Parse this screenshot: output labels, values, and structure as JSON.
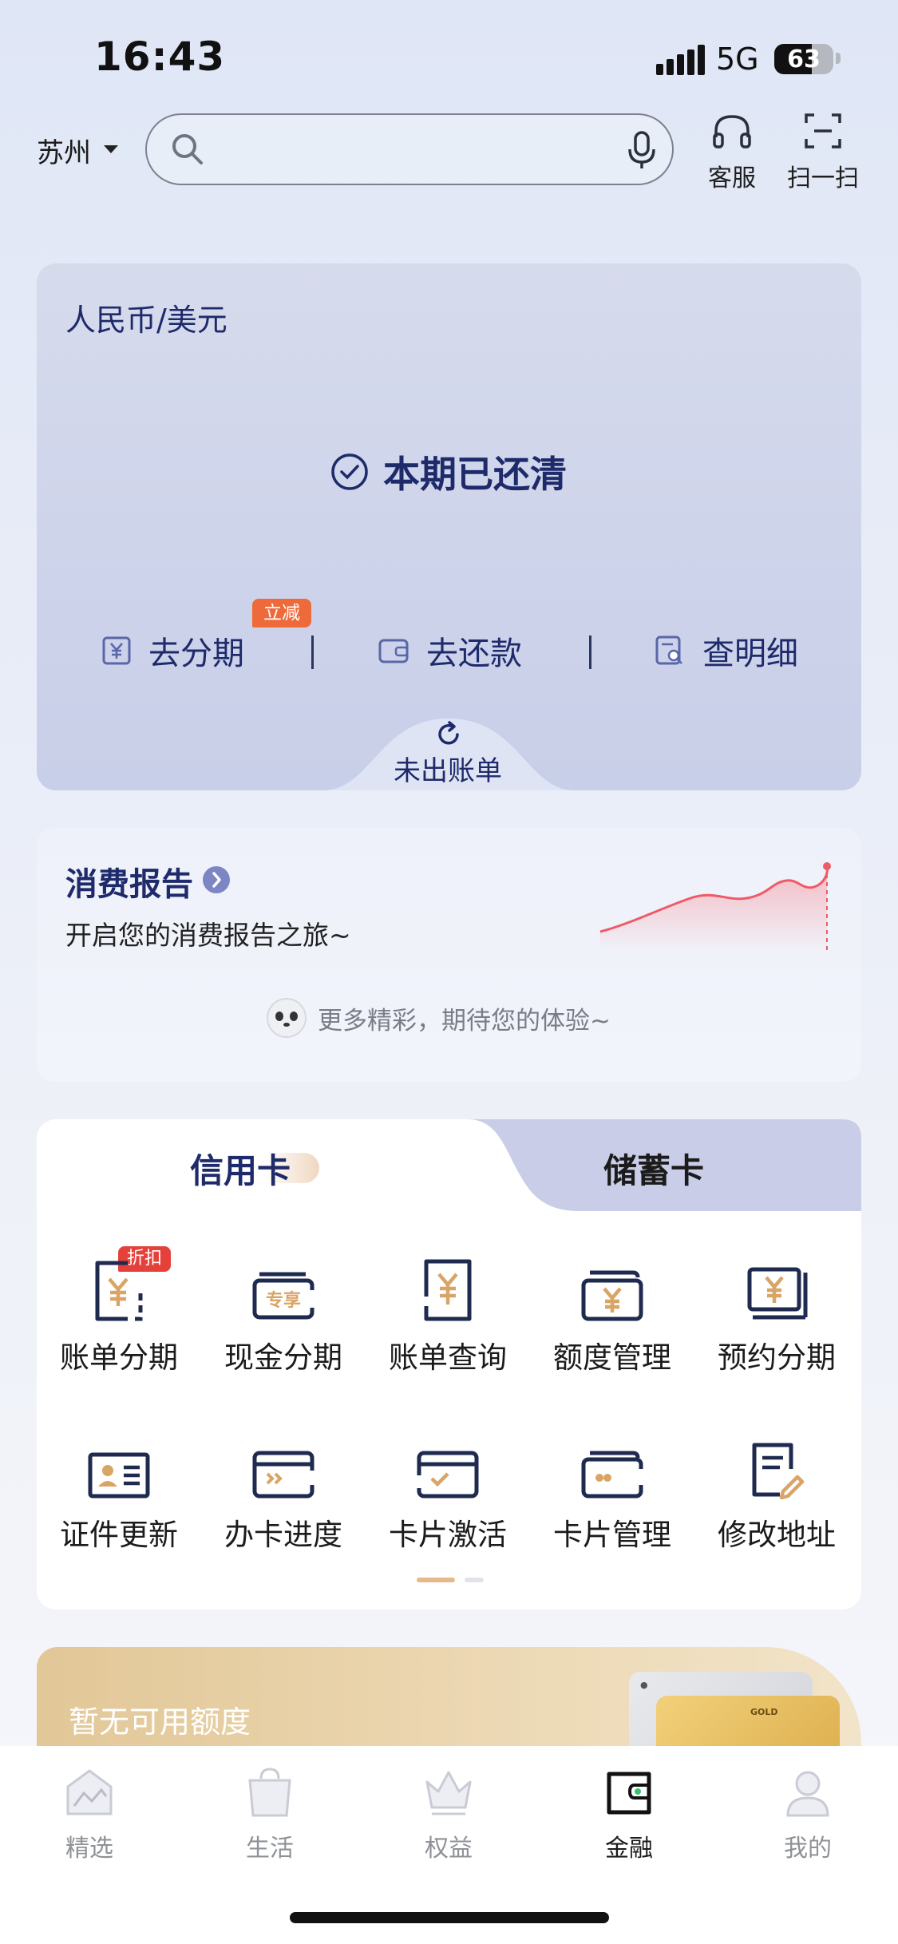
{
  "status_bar": {
    "time": "16:43",
    "network": "5G",
    "battery": "63"
  },
  "header": {
    "city": "苏州",
    "search_placeholder": "",
    "service_label": "客服",
    "scan_label": "扫一扫"
  },
  "bill_card": {
    "currency": "人民币/美元",
    "status": "本期已还清",
    "actions": [
      {
        "label": "去分期",
        "badge": "立减"
      },
      {
        "label": "去还款"
      },
      {
        "label": "查明细"
      }
    ],
    "not_billed": "未出账单"
  },
  "report": {
    "title": "消费报告",
    "subtitle": "开启您的消费报告之旅~",
    "more": "更多精彩，期待您的体验~"
  },
  "card_services": {
    "tabs": [
      "信用卡",
      "储蓄卡"
    ],
    "active_tab": 0,
    "row1": [
      {
        "label": "账单分期",
        "icon": "bill-installment-icon",
        "badge": "折扣"
      },
      {
        "label": "现金分期",
        "icon": "cash-installment-icon",
        "icon_text": "专享"
      },
      {
        "label": "账单查询",
        "icon": "bill-query-icon"
      },
      {
        "label": "额度管理",
        "icon": "limit-manage-icon"
      },
      {
        "label": "预约分期",
        "icon": "reserve-installment-icon"
      }
    ],
    "row2": [
      {
        "label": "证件更新",
        "icon": "id-update-icon"
      },
      {
        "label": "办卡进度",
        "icon": "card-progress-icon"
      },
      {
        "label": "卡片激活",
        "icon": "card-activate-icon"
      },
      {
        "label": "卡片管理",
        "icon": "card-manage-icon"
      },
      {
        "label": "修改地址",
        "icon": "edit-address-icon"
      }
    ],
    "page_indicator": {
      "pages": 2,
      "current": 1
    }
  },
  "promo": {
    "text": "暂无可用额度",
    "card_label": "GOLD"
  },
  "tab_bar": {
    "items": [
      {
        "label": "精选",
        "icon": "featured-icon"
      },
      {
        "label": "生活",
        "icon": "life-icon"
      },
      {
        "label": "权益",
        "icon": "rights-icon"
      },
      {
        "label": "金融",
        "icon": "finance-icon",
        "active": true
      },
      {
        "label": "我的",
        "icon": "profile-icon"
      }
    ]
  },
  "colors": {
    "brand_navy": "#1f2a6b",
    "accent_red": "#e5413b",
    "accent_orange": "#ef6a3a",
    "icon_gold": "#d9a567",
    "chart_red": "#ee5b67"
  }
}
